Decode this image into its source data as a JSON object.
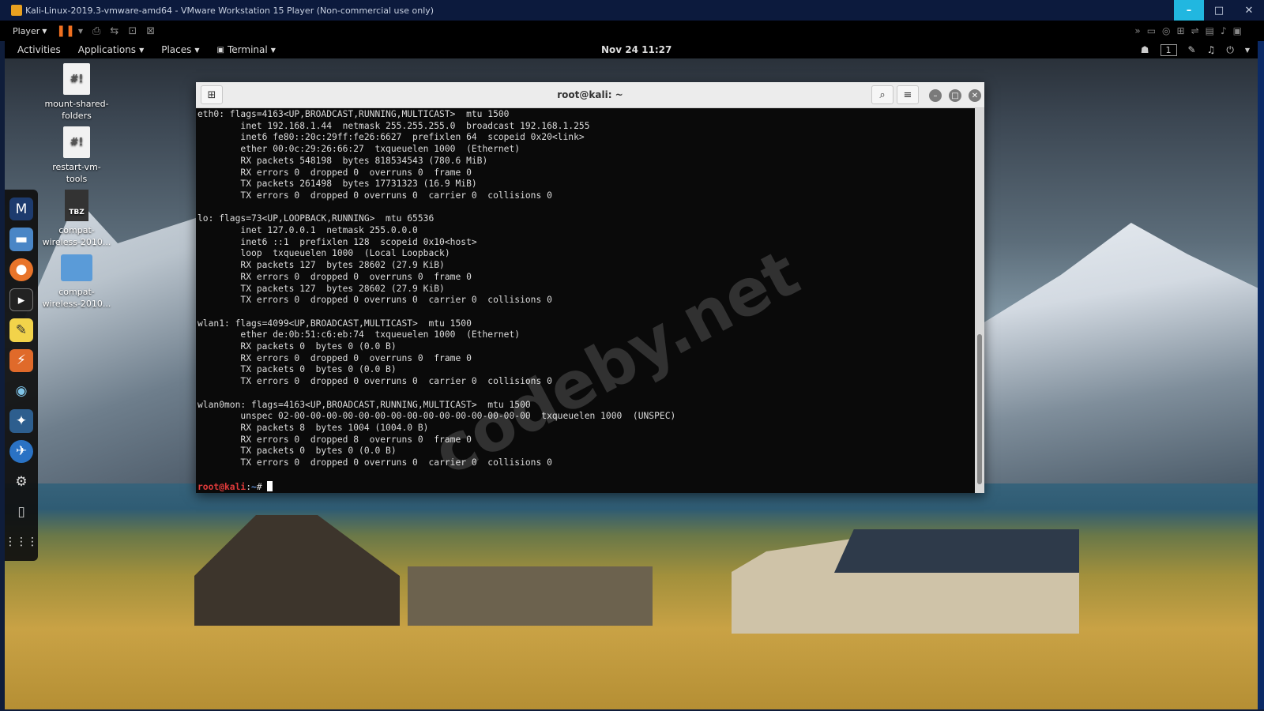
{
  "vmware": {
    "title": "Kali-Linux-2019.3-vmware-amd64 - VMware Workstation 15 Player (Non-commercial use only)",
    "player_label": "Player",
    "minimize": "–",
    "maximize": "□",
    "close": "✕",
    "accent": "#21b7e0"
  },
  "gnome": {
    "activities": "Activities",
    "applications": "Applications",
    "places": "Places",
    "terminal": "Terminal",
    "clock": "Nov 24  11:27",
    "workspace": "1"
  },
  "desktop_icons": [
    {
      "label": "mount-shared-\nfolders",
      "glyph": "#!"
    },
    {
      "label": "restart-vm-\ntools",
      "glyph": "#!"
    },
    {
      "label": "compat-\nwireless-2010...",
      "glyph": "TBZ"
    },
    {
      "label": "compat-\nwireless-2010...",
      "glyph": ""
    }
  ],
  "dock": [
    "metasploit-icon",
    "files-icon",
    "firefox-icon",
    "terminal-icon",
    "text-editor-icon",
    "burpsuite-icon",
    "eye-icon",
    "zenmap-icon",
    "maltego-icon",
    "settings-icon",
    "trash-icon",
    "app-grid-icon"
  ],
  "terminal": {
    "title": "root@kali: ~",
    "lines": [
      "eth0: flags=4163<UP,BROADCAST,RUNNING,MULTICAST>  mtu 1500",
      "        inet 192.168.1.44  netmask 255.255.255.0  broadcast 192.168.1.255",
      "        inet6 fe80::20c:29ff:fe26:6627  prefixlen 64  scopeid 0x20<link>",
      "        ether 00:0c:29:26:66:27  txqueuelen 1000  (Ethernet)",
      "        RX packets 548198  bytes 818534543 (780.6 MiB)",
      "        RX errors 0  dropped 0  overruns 0  frame 0",
      "        TX packets 261498  bytes 17731323 (16.9 MiB)",
      "        TX errors 0  dropped 0 overruns 0  carrier 0  collisions 0",
      "",
      "lo: flags=73<UP,LOOPBACK,RUNNING>  mtu 65536",
      "        inet 127.0.0.1  netmask 255.0.0.0",
      "        inet6 ::1  prefixlen 128  scopeid 0x10<host>",
      "        loop  txqueuelen 1000  (Local Loopback)",
      "        RX packets 127  bytes 28602 (27.9 KiB)",
      "        RX errors 0  dropped 0  overruns 0  frame 0",
      "        TX packets 127  bytes 28602 (27.9 KiB)",
      "        TX errors 0  dropped 0 overruns 0  carrier 0  collisions 0",
      "",
      "wlan1: flags=4099<UP,BROADCAST,MULTICAST>  mtu 1500",
      "        ether de:0b:51:c6:eb:74  txqueuelen 1000  (Ethernet)",
      "        RX packets 0  bytes 0 (0.0 B)",
      "        RX errors 0  dropped 0  overruns 0  frame 0",
      "        TX packets 0  bytes 0 (0.0 B)",
      "        TX errors 0  dropped 0 overruns 0  carrier 0  collisions 0",
      "",
      "wlan0mon: flags=4163<UP,BROADCAST,RUNNING,MULTICAST>  mtu 1500",
      "        unspec 02-00-00-00-00-00-00-00-00-00-00-00-00-00-00-00  txqueuelen 1000  (UNSPEC)",
      "        RX packets 8  bytes 1004 (1004.0 B)",
      "        RX errors 0  dropped 8  overruns 0  frame 0",
      "        TX packets 0  bytes 0 (0.0 B)",
      "        TX errors 0  dropped 0 overruns 0  carrier 0  collisions 0",
      ""
    ],
    "prompt_user": "root@kali",
    "prompt_sep": ":",
    "prompt_path": "~",
    "prompt_symbol": "# "
  },
  "watermark": "codeby.net"
}
